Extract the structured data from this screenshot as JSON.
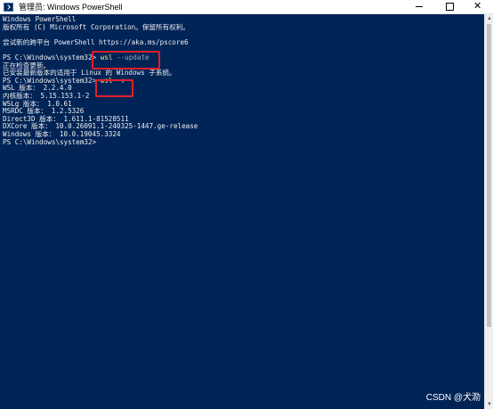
{
  "window": {
    "title": "管理员: Windows PowerShell",
    "icon": "powershell-icon",
    "controls": {
      "minimize": "minimize-icon",
      "maximize": "maximize-icon",
      "close": "✕"
    }
  },
  "console": {
    "background": "#012456",
    "text_color": "#eeedf0",
    "command_color": "#f2e48a",
    "lines": [
      {
        "text": "Windows PowerShell"
      },
      {
        "text": "版权所有 (C) Microsoft Corporation。保留所有权利。"
      },
      {
        "text": ""
      },
      {
        "text": "尝试新的跨平台 PowerShell https://aka.ms/pscore6"
      },
      {
        "text": ""
      },
      {
        "prompt": "PS C:\\Windows\\system32> ",
        "cmd": "wsl",
        "arg": " --update"
      },
      {
        "text": "正在检查更新。"
      },
      {
        "text": "已安装最新版本的适用于 Linux 的 Windows 子系统。"
      },
      {
        "prompt": "PS C:\\Windows\\system32> ",
        "cmd": "wsl",
        "arg": " -v"
      },
      {
        "text": "WSL 版本： 2.2.4.0"
      },
      {
        "text": "内核版本： 5.15.153.1-2"
      },
      {
        "text": "WSLg 版本： 1.0.61"
      },
      {
        "text": "MSRDC 版本： 1.2.5326"
      },
      {
        "text": "Direct3D 版本： 1.611.1-81528511"
      },
      {
        "text": "DXCore 版本： 10.0.26091.1-240325-1447.ge-release"
      },
      {
        "text": "Windows 版本： 10.0.19045.3324"
      },
      {
        "text": "PS C:\\Windows\\system32>"
      }
    ]
  },
  "highlight_color": "#e0202a",
  "watermark": "CSDN @犬泐"
}
